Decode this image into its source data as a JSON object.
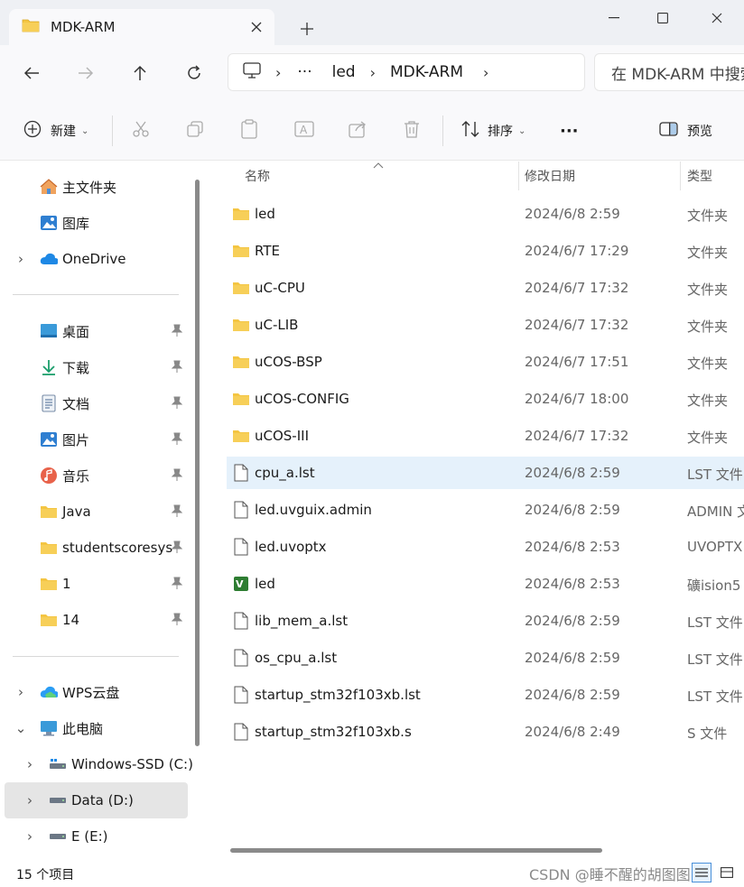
{
  "window": {
    "tab_title": "MDK-ARM"
  },
  "address": {
    "crumbs": [
      "···",
      "led",
      "MDK-ARM"
    ],
    "search_placeholder": "在 MDK-ARM 中搜索"
  },
  "toolbar": {
    "new_label": "新建",
    "sort_label": "排序",
    "more_label": "···",
    "preview_label": "预览"
  },
  "sidebar": {
    "items": [
      {
        "label": "主文件夹",
        "icon": "home-icon"
      },
      {
        "label": "图库",
        "icon": "gallery-icon"
      },
      {
        "label": "OneDrive",
        "icon": "cloud-icon"
      },
      {
        "label": "桌面",
        "icon": "desktop-icon"
      },
      {
        "label": "下载",
        "icon": "download-icon"
      },
      {
        "label": "文档",
        "icon": "document-icon"
      },
      {
        "label": "图片",
        "icon": "pictures-icon"
      },
      {
        "label": "音乐",
        "icon": "music-icon"
      },
      {
        "label": "Java",
        "icon": "folder-icon"
      },
      {
        "label": "studentscoresys",
        "icon": "folder-icon"
      },
      {
        "label": "1",
        "icon": "folder-icon"
      },
      {
        "label": "14",
        "icon": "folder-icon"
      },
      {
        "label": "WPS云盘",
        "icon": "cloud-icon"
      },
      {
        "label": "此电脑",
        "icon": "pc-icon"
      },
      {
        "label": "Windows-SSD (C:)",
        "icon": "drive-icon"
      },
      {
        "label": "Data (D:)",
        "icon": "drive-icon"
      },
      {
        "label": "E (E:)",
        "icon": "drive-icon"
      }
    ]
  },
  "columns": {
    "name": "名称",
    "date": "修改日期",
    "type": "类型"
  },
  "files": [
    {
      "name": "led",
      "date": "2024/6/8 2:59",
      "type": "文件夹",
      "kind": "folder"
    },
    {
      "name": "RTE",
      "date": "2024/6/7 17:29",
      "type": "文件夹",
      "kind": "folder"
    },
    {
      "name": "uC-CPU",
      "date": "2024/6/7 17:32",
      "type": "文件夹",
      "kind": "folder"
    },
    {
      "name": "uC-LIB",
      "date": "2024/6/7 17:32",
      "type": "文件夹",
      "kind": "folder"
    },
    {
      "name": "uCOS-BSP",
      "date": "2024/6/7 17:51",
      "type": "文件夹",
      "kind": "folder"
    },
    {
      "name": "uCOS-CONFIG",
      "date": "2024/6/7 18:00",
      "type": "文件夹",
      "kind": "folder"
    },
    {
      "name": "uCOS-III",
      "date": "2024/6/7 17:32",
      "type": "文件夹",
      "kind": "folder"
    },
    {
      "name": "cpu_a.lst",
      "date": "2024/6/8 2:59",
      "type": "LST 文件",
      "kind": "file"
    },
    {
      "name": "led.uvguix.admin",
      "date": "2024/6/8 2:59",
      "type": "ADMIN 文",
      "kind": "file"
    },
    {
      "name": "led.uvoptx",
      "date": "2024/6/8 2:53",
      "type": "UVOPTX",
      "kind": "file"
    },
    {
      "name": "led",
      "date": "2024/6/8 2:53",
      "type": "礦ision5",
      "kind": "keil"
    },
    {
      "name": "lib_mem_a.lst",
      "date": "2024/6/8 2:59",
      "type": "LST 文件",
      "kind": "file"
    },
    {
      "name": "os_cpu_a.lst",
      "date": "2024/6/8 2:59",
      "type": "LST 文件",
      "kind": "file"
    },
    {
      "name": "startup_stm32f103xb.lst",
      "date": "2024/6/8 2:59",
      "type": "LST 文件",
      "kind": "file"
    },
    {
      "name": "startup_stm32f103xb.s",
      "date": "2024/6/8 2:49",
      "type": "S 文件",
      "kind": "file"
    }
  ],
  "status": {
    "count": "15 个项目",
    "watermark": "CSDN @睡不醒的胡图图"
  },
  "colors": {
    "folder": "#f4c542",
    "accent": "#0067c0",
    "highlight": "#e5f1fb"
  }
}
